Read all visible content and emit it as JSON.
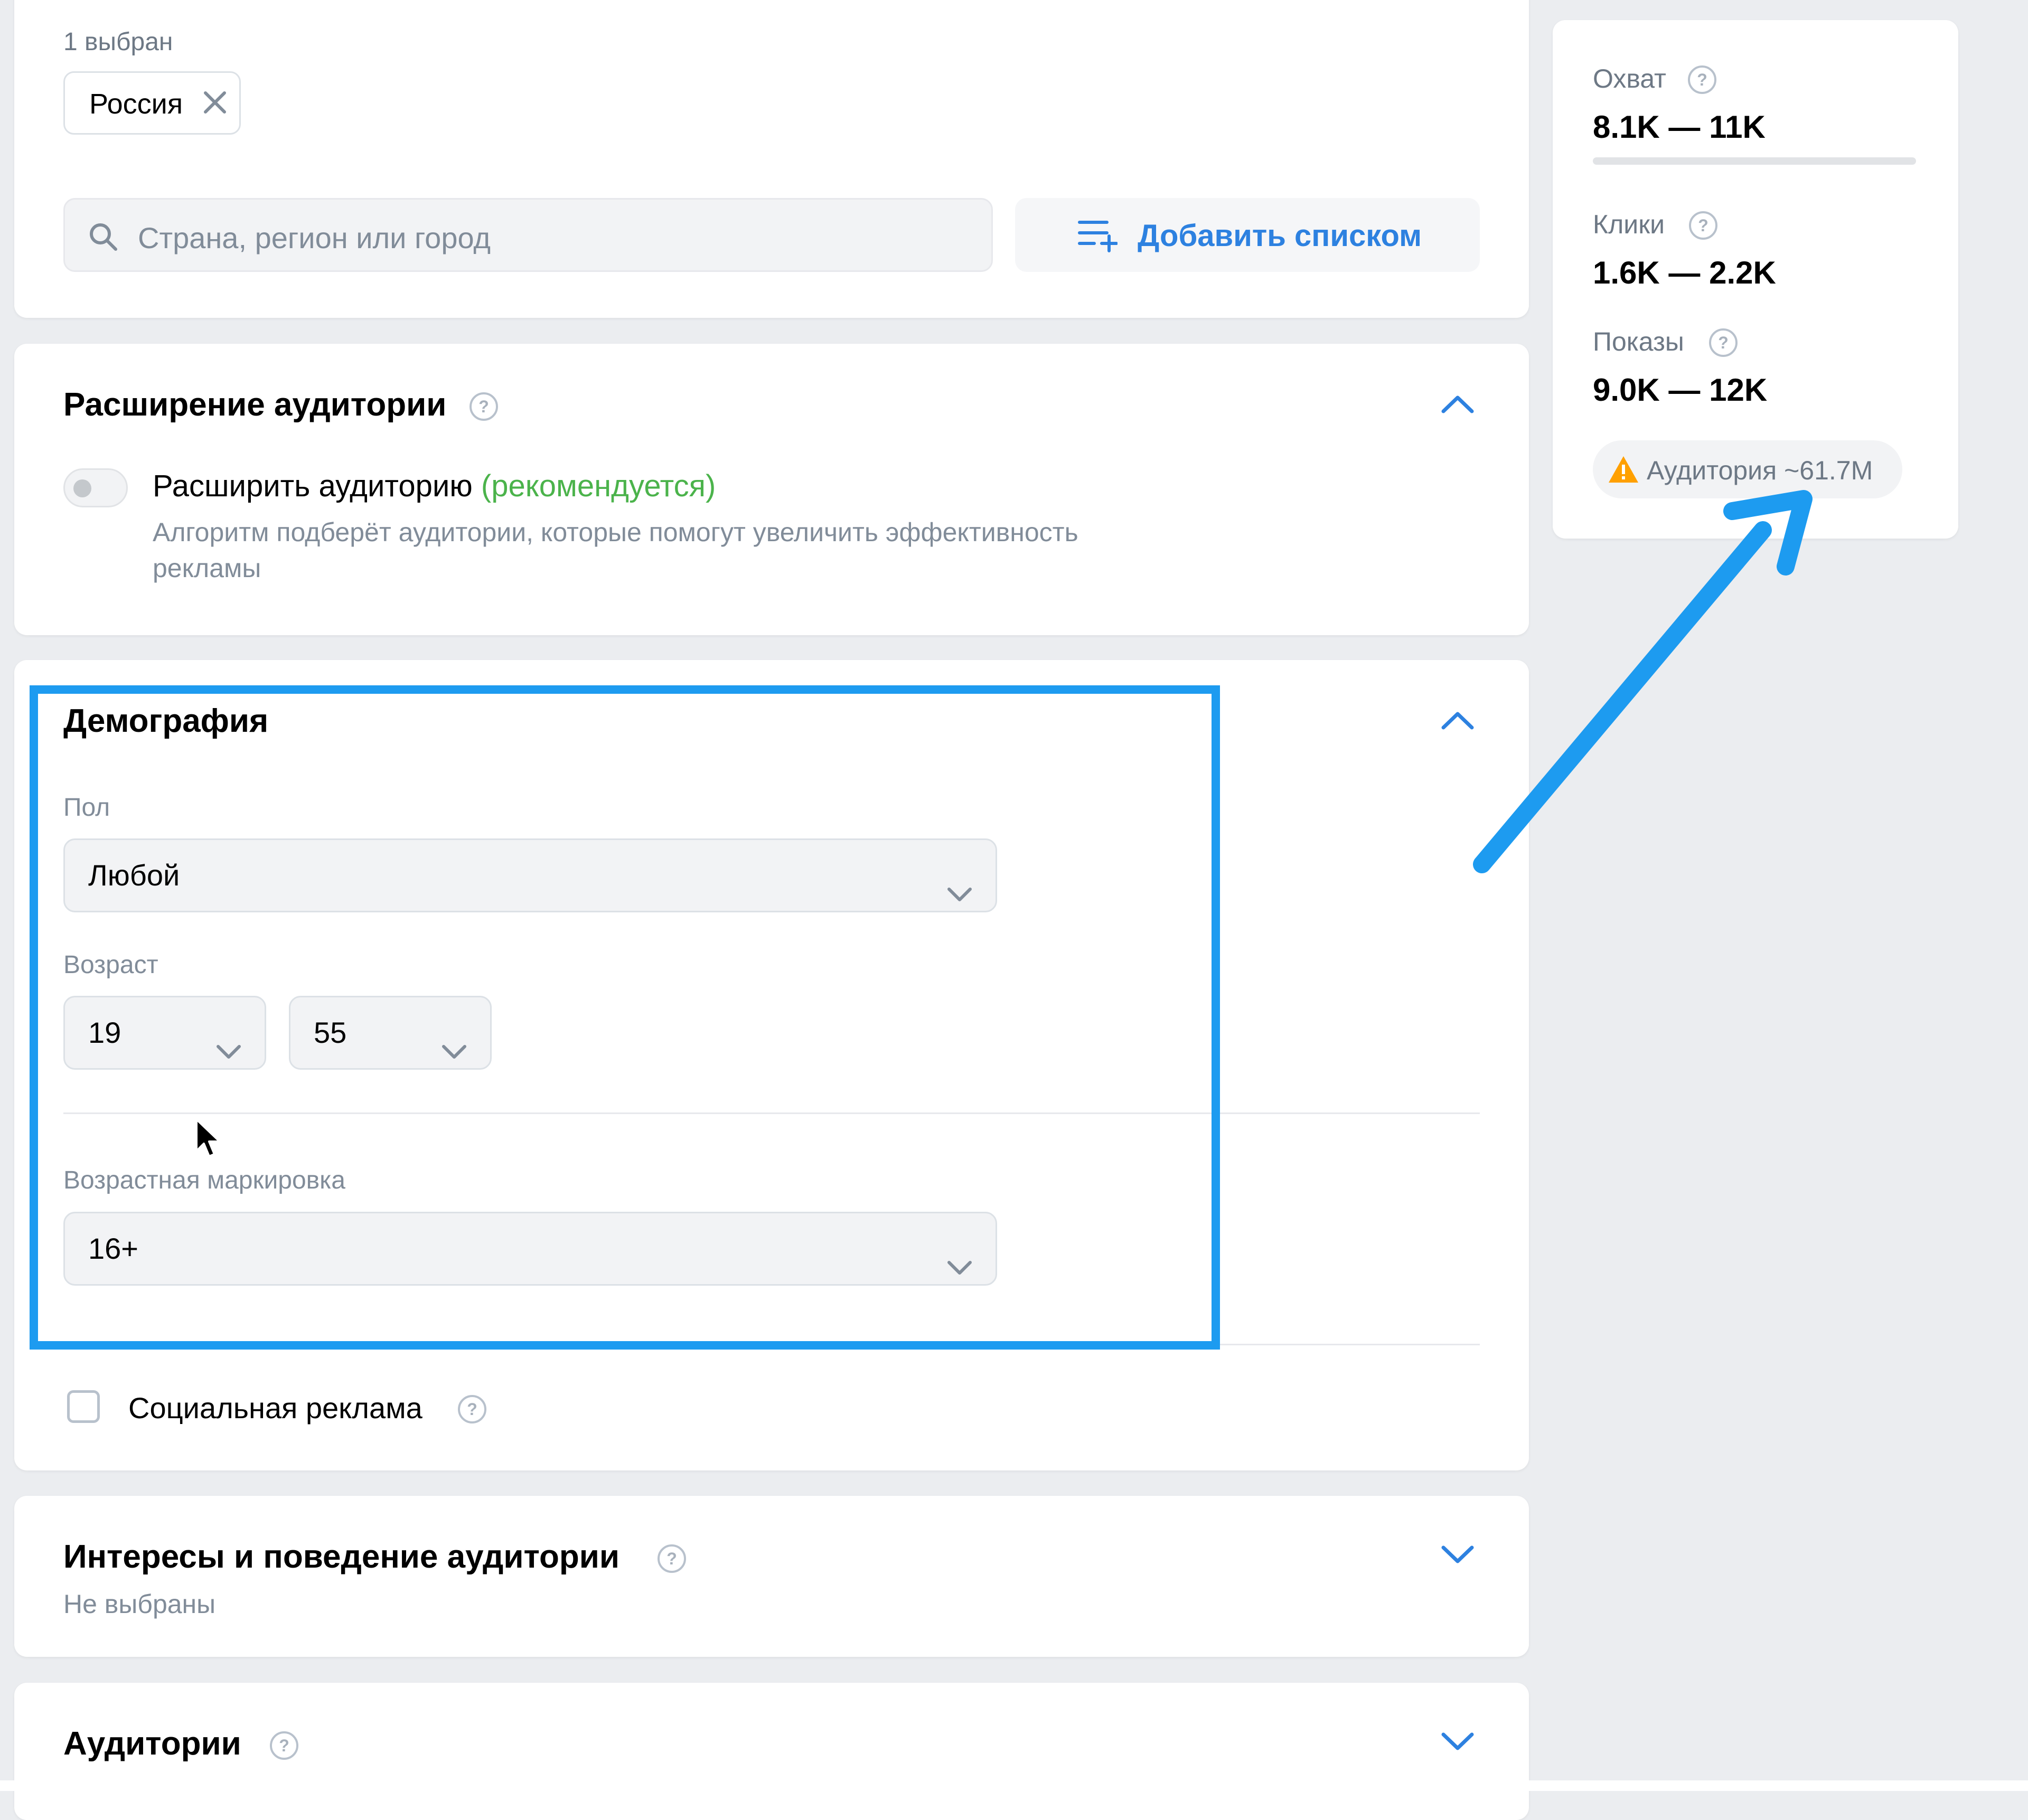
{
  "geo": {
    "selected_count": "1 выбран",
    "chip_label": "Россия",
    "search_placeholder": "Страна, регион или город",
    "add_list_label": "Добавить списком"
  },
  "expansion": {
    "title": "Расширение аудитории",
    "toggle_label": "Расширить аудиторию",
    "toggle_recommended": "(рекомендуется)",
    "toggle_enabled": false,
    "description_line1": "Алгоритм подберёт аудитории, которые помогут увеличить эффективность",
    "description_line2": "рекламы"
  },
  "demography": {
    "title": "Демография",
    "gender_label": "Пол",
    "gender_value": "Любой",
    "age_label": "Возраст",
    "age_from": "19",
    "age_to": "55",
    "age_rating_label": "Возрастная маркировка",
    "age_rating_value": "16+",
    "social_ad_label": "Социальная реклама",
    "social_ad_checked": false
  },
  "interests": {
    "title": "Интересы и поведение аудитории",
    "subtitle": "Не выбраны"
  },
  "audiences": {
    "title": "Аудитории"
  },
  "forecast": {
    "reach_label": "Охват",
    "reach_value": "8.1K — 11K",
    "clicks_label": "Клики",
    "clicks_value": "1.6K — 2.2K",
    "impressions_label": "Показы",
    "impressions_value": "9.0K — 12K",
    "audience_badge": "Аудитория ~61.7M"
  },
  "colors": {
    "accent": "#2d81e0",
    "recommended": "#4bb34b",
    "annotation": "#1d9bf0",
    "warning": "#ffa000"
  }
}
